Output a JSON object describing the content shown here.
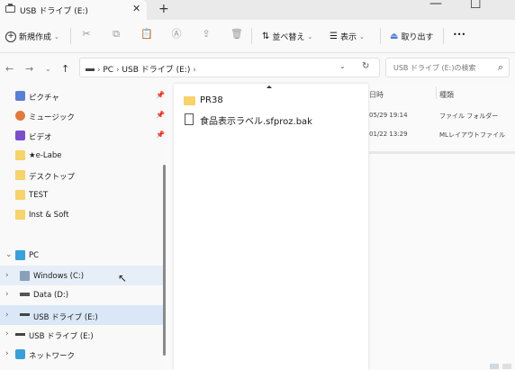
{
  "tab": {
    "title": "USB ドライブ (E:)",
    "close": "✕",
    "new_tab": "+"
  },
  "window_controls": {
    "minimize": "—",
    "maximize": "☐"
  },
  "command_bar": {
    "new": "新規作成",
    "sort": "並べ替え",
    "view": "表示",
    "eject": "取り出す",
    "more": "•••"
  },
  "address": {
    "crumbs": [
      "PC",
      "USB ドライブ (E:)"
    ],
    "search_placeholder": "USB ドライブ (E:)の検索"
  },
  "nav": {
    "quick_access": [
      {
        "label": "ピクチャ",
        "pinned": true,
        "icon": "pictures-icon"
      },
      {
        "label": "ミュージック",
        "pinned": true,
        "icon": "music-icon"
      },
      {
        "label": "ビデオ",
        "pinned": true,
        "icon": "video-icon"
      },
      {
        "label": "★e-Labe",
        "pinned": false,
        "icon": "folder-icon"
      },
      {
        "label": "デスクトップ",
        "pinned": false,
        "icon": "folder-icon"
      },
      {
        "label": "TEST",
        "pinned": false,
        "icon": "folder-icon"
      },
      {
        "label": "Inst & Soft",
        "pinned": false,
        "icon": "folder-icon"
      }
    ],
    "pc": "PC",
    "drives": [
      {
        "label": "Windows (C:)",
        "icon": "windows-drive-icon"
      },
      {
        "label": "Data (D:)",
        "icon": "drive-icon"
      },
      {
        "label": "USB ドライブ (E:)",
        "icon": "usb-drive-icon"
      }
    ],
    "usb_root": "USB ドライブ (E:)",
    "network": "ネットワーク"
  },
  "columns": {
    "date": "日時",
    "type": "種類"
  },
  "rows": [
    {
      "date": "05/29 19:14",
      "type": "ファイル フォルダー"
    },
    {
      "date": "01/22 13:29",
      "type": "MLレイアウトファイル"
    }
  ],
  "popup_items": [
    {
      "label": "PR38",
      "icon": "folder-icon"
    },
    {
      "label": "食品表示ラベル.sfproz.bak",
      "icon": "file-icon"
    }
  ]
}
